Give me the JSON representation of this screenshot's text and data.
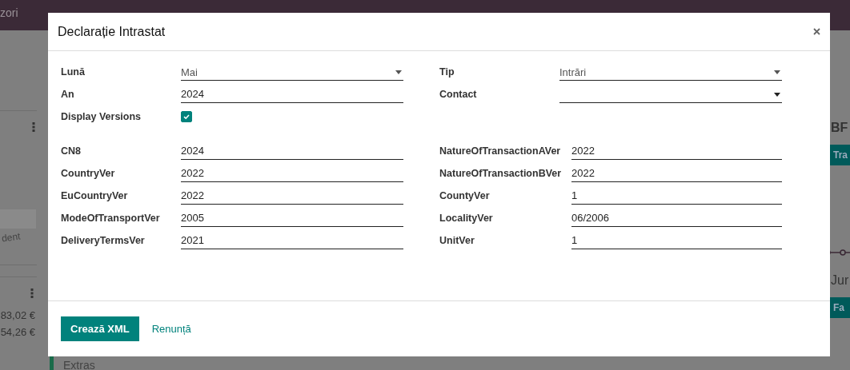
{
  "navbar": {
    "items": [
      "zori"
    ]
  },
  "background": {
    "left_texts": [
      "dent"
    ],
    "amounts": [
      "83,02 €",
      "54,26 €"
    ],
    "right_title": "BF",
    "right_button": "Tra",
    "right_title_2": "Jur",
    "right_button_2": "Fa",
    "bottom_text": "Extras"
  },
  "dialog": {
    "title": "Declarație Intrastat",
    "left_fields": [
      {
        "kind": "select",
        "label": "Lună",
        "value": "Mai"
      },
      {
        "kind": "input",
        "label": "An",
        "value": "2024"
      },
      {
        "kind": "checkbox",
        "label": "Display Versions",
        "checked": true
      }
    ],
    "right_fields": [
      {
        "kind": "select",
        "label": "Tip",
        "value": "Intrări"
      },
      {
        "kind": "select",
        "label": "Contact"
      }
    ],
    "version_left": [
      {
        "label": "CN8",
        "value": "2024"
      },
      {
        "label": "CountryVer",
        "value": "2022"
      },
      {
        "label": "EuCountryVer",
        "value": "2022"
      },
      {
        "label": "ModeOfTransportVer",
        "value": "2005"
      },
      {
        "label": "DeliveryTermsVer",
        "value": "2021"
      }
    ],
    "version_right": [
      {
        "label": "NatureOfTransactionAVer",
        "value": "2022"
      },
      {
        "label": "NatureOfTransactionBVer",
        "value": "2022"
      },
      {
        "label": "CountyVer",
        "value": "1"
      },
      {
        "label": "LocalityVer",
        "value": "06/2006"
      },
      {
        "label": "UnitVer",
        "value": "1"
      }
    ],
    "buttons": [
      {
        "kind": "primary",
        "label": "Crează XML"
      },
      {
        "kind": "link",
        "label": "Renunță"
      }
    ]
  }
}
